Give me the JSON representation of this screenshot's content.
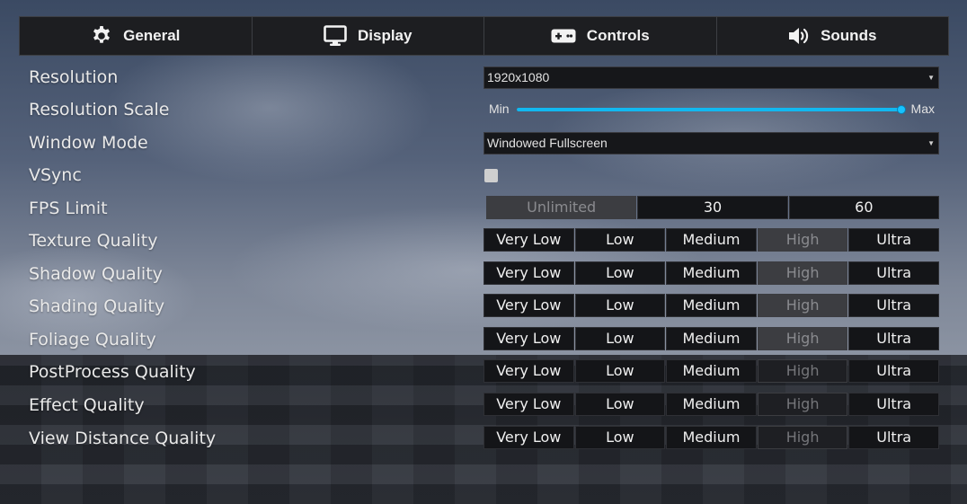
{
  "tabs": [
    {
      "label": "General",
      "icon": "gear-icon"
    },
    {
      "label": "Display",
      "icon": "monitor-icon"
    },
    {
      "label": "Controls",
      "icon": "gamepad-icon"
    },
    {
      "label": "Sounds",
      "icon": "speaker-icon"
    }
  ],
  "settings": {
    "resolution": {
      "label": "Resolution",
      "value": "1920x1080"
    },
    "resolution_scale": {
      "label": "Resolution Scale",
      "min_label": "Min",
      "max_label": "Max",
      "value_fraction": 1.0
    },
    "window_mode": {
      "label": "Window Mode",
      "value": "Windowed Fullscreen"
    },
    "vsync": {
      "label": "VSync",
      "checked": false
    },
    "fps_limit": {
      "label": "FPS Limit",
      "options": [
        "Unlimited",
        "30",
        "60"
      ],
      "selected": "Unlimited"
    },
    "quality_options": [
      "Very Low",
      "Low",
      "Medium",
      "High",
      "Ultra"
    ],
    "quality_rows": [
      {
        "label": "Texture Quality",
        "selected": "High"
      },
      {
        "label": "Shadow Quality",
        "selected": "High"
      },
      {
        "label": "Shading Quality",
        "selected": "High"
      },
      {
        "label": "Foliage Quality",
        "selected": "High"
      },
      {
        "label": "PostProcess Quality",
        "selected": "High"
      },
      {
        "label": "Effect Quality",
        "selected": "High"
      },
      {
        "label": "View Distance Quality",
        "selected": "High"
      }
    ]
  },
  "colors": {
    "accent": "#12b8f0",
    "selected_segment": "#3c3d41",
    "segment_bg": "#141518"
  }
}
